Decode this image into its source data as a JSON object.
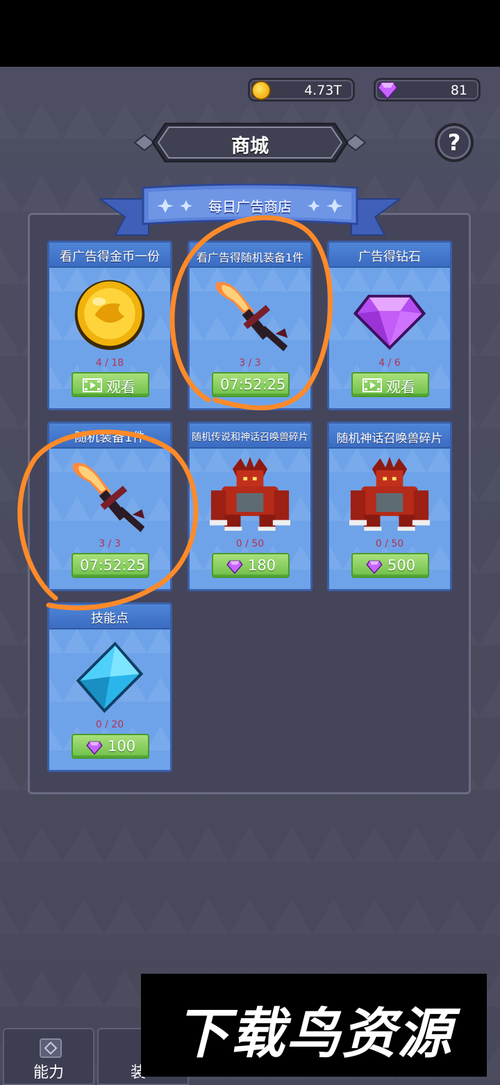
{
  "currency": {
    "coins": "4.73T",
    "gems": "81"
  },
  "header": {
    "title": "商城",
    "help_label": "?"
  },
  "section": {
    "title": "每日广告商店"
  },
  "cards": [
    {
      "title": "看广告得金币一份",
      "count": "4 / 18",
      "button": "观看",
      "icon": "gold-coin-icon",
      "button_icon": "video-icon"
    },
    {
      "title": "看广告得随机装备1件",
      "count": "3 / 3",
      "button": "07:52:25",
      "icon": "flame-sword-icon"
    },
    {
      "title": "广告得钻石",
      "count": "4 / 6",
      "button": "观看",
      "icon": "purple-gem-icon",
      "button_icon": "video-icon"
    },
    {
      "title": "随机装备1件",
      "count": "3 / 3",
      "button": "07:52:25",
      "icon": "flame-sword-icon"
    },
    {
      "title": "随机传说和神话召唤兽碎片",
      "count": "0 / 50",
      "button": "180",
      "icon": "red-beast-icon",
      "button_icon": "gem-icon"
    },
    {
      "title": "随机神话召唤兽碎片",
      "count": "0 / 50",
      "button": "500",
      "icon": "red-beast-icon",
      "button_icon": "gem-icon"
    },
    {
      "title": "技能点",
      "count": "0 / 20",
      "button": "100",
      "icon": "blue-crystal-icon",
      "button_icon": "gem-icon"
    }
  ],
  "bottom_tabs": [
    {
      "label": "能力"
    },
    {
      "label": "装"
    }
  ],
  "watermark": "下载鸟资源",
  "colors": {
    "card": "#6ea3e9",
    "button": "#7cc852",
    "count": "#b63050",
    "annotation": "#ff8a2a"
  }
}
